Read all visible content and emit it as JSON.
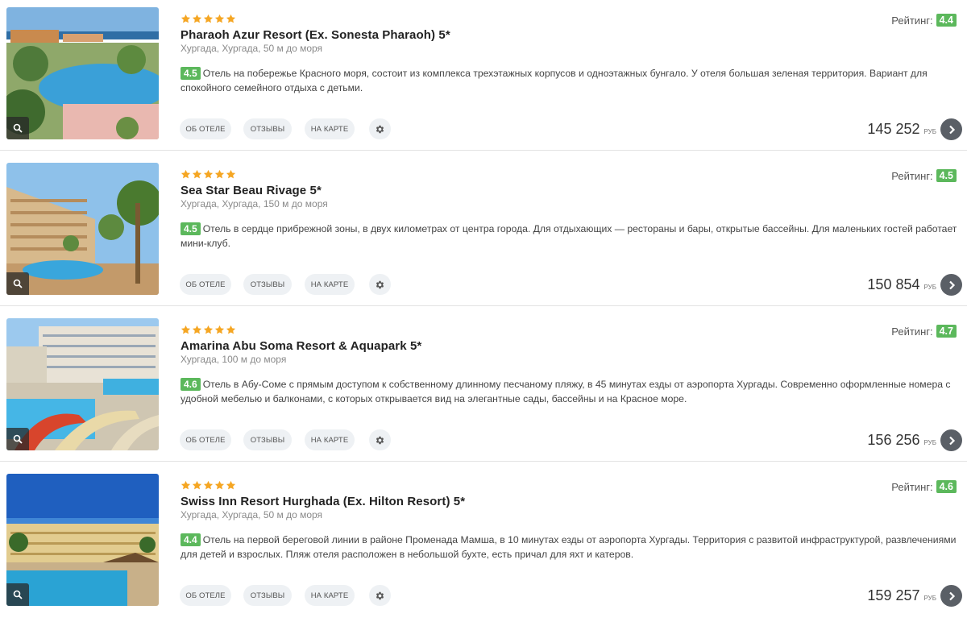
{
  "ui": {
    "rating_label": "Рейтинг:",
    "about_label": "ОБ ОТЕЛЕ",
    "reviews_label": "ОТЗЫВЫ",
    "map_label": "НА КАРТЕ",
    "currency": "РУБ",
    "star_color": "#f5a623",
    "badge_color": "#5cb85c"
  },
  "hotels": [
    {
      "stars": 5,
      "name": "Pharaoh Azur Resort (Ex. Sonesta Pharaoh) 5*",
      "location": "Хургада, Хургада, 50 м до моря",
      "score": "4.5",
      "description": "Отель на побережье Красного моря, состоит из комплекса трехэтажных корпусов и одноэтажных бунгало. У отеля большая зеленая территория. Вариант для спокойного семейного отдыха с детьми.",
      "rating": "4.4",
      "price": "145 252"
    },
    {
      "stars": 5,
      "name": "Sea Star Beau Rivage 5*",
      "location": "Хургада, Хургада, 150 м до моря",
      "score": "4.5",
      "description": "Отель в сердце прибрежной зоны, в двух километрах от центра города. Для отдыхающих — рестораны и бары, открытые бассейны. Для маленьких гостей работает мини-клуб.",
      "rating": "4.5",
      "price": "150 854"
    },
    {
      "stars": 5,
      "name": "Amarina Abu Soma Resort & Aquapark 5*",
      "location": "Хургада, 100 м до моря",
      "score": "4.6",
      "description": "Отель в Абу-Соме с прямым доступом к собственному длинному песчаному пляжу, в 45 минутах езды от аэропорта Хургады. Современно оформленные номера с удобной мебелью и балконами, с которых открывается вид на элегантные сады, бассейны и на Красное море.",
      "rating": "4.7",
      "price": "156 256"
    },
    {
      "stars": 5,
      "name": "Swiss Inn Resort Hurghada (Ex. Hilton Resort) 5*",
      "location": "Хургада, Хургада, 50 м до моря",
      "score": "4.4",
      "description": "Отель на первой береговой линии в районе Променада Мамша, в 10 минутах езды от аэропорта Хургады. Территория с развитой инфраструктурой, развлечениями для детей и взрослых. Пляж отеля расположен в небольшой бухте, есть причал для яхт и катеров.",
      "rating": "4.6",
      "price": "159 257"
    }
  ]
}
